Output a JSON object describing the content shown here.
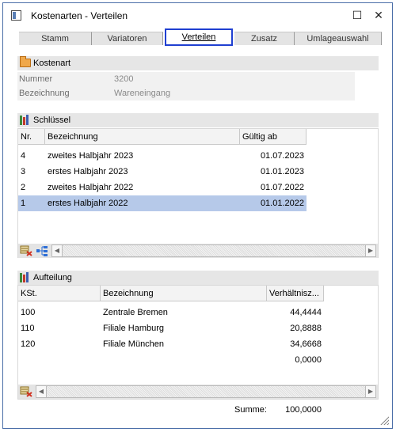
{
  "window": {
    "title": "Kostenarten - Verteilen",
    "maximize_glyph": "☐",
    "close_glyph": "✕"
  },
  "tabs": [
    {
      "label": "Stamm",
      "active": false
    },
    {
      "label": "Variatoren",
      "active": false
    },
    {
      "label": "Verteilen",
      "active": true
    },
    {
      "label": "Zusatz",
      "active": false
    },
    {
      "label": "Umlageauswahl",
      "active": false
    }
  ],
  "kostenart": {
    "section_title": "Kostenart",
    "icon": "folder-icon",
    "nummer_label": "Nummer",
    "nummer_value": "3200",
    "bezeichnung_label": "Bezeichnung",
    "bezeichnung_value": "Wareneingang"
  },
  "schluessel": {
    "section_title": "Schlüssel",
    "icon": "books-icon",
    "columns": [
      "Nr.",
      "Bezeichnung",
      "Gültig ab"
    ],
    "rows": [
      {
        "nr": "4",
        "bezeichnung": "zweites Halbjahr 2023",
        "gueltig_ab": "01.07.2023",
        "selected": false
      },
      {
        "nr": "3",
        "bezeichnung": "erstes Halbjahr 2023",
        "gueltig_ab": "01.01.2023",
        "selected": false
      },
      {
        "nr": "2",
        "bezeichnung": "zweites  Halbjahr 2022",
        "gueltig_ab": "01.07.2022",
        "selected": false
      },
      {
        "nr": "1",
        "bezeichnung": "erstes Halbjahr 2022",
        "gueltig_ab": "01.01.2022",
        "selected": true
      }
    ]
  },
  "aufteilung": {
    "section_title": "Aufteilung",
    "icon": "books-icon",
    "columns": [
      "KSt.",
      "Bezeichnung",
      "Verhältnisz..."
    ],
    "rows": [
      {
        "kst": "100",
        "bezeichnung": "Zentrale Bremen",
        "verhaeltnis": "44,4444"
      },
      {
        "kst": "110",
        "bezeichnung": "Filiale Hamburg",
        "verhaeltnis": "20,8888"
      },
      {
        "kst": "120",
        "bezeichnung": "Filiale München",
        "verhaeltnis": "34,6668"
      },
      {
        "kst": "",
        "bezeichnung": "",
        "verhaeltnis": "0,0000"
      }
    ],
    "summe_label": "Summe:",
    "summe_value": "100,0000"
  },
  "scroll_arrows": {
    "left": "◀",
    "right": "▶"
  },
  "colors": {
    "selection": "#b6c9e9",
    "active_tab_border": "#1f3fd1",
    "header_bg": "#e6e6e6"
  }
}
